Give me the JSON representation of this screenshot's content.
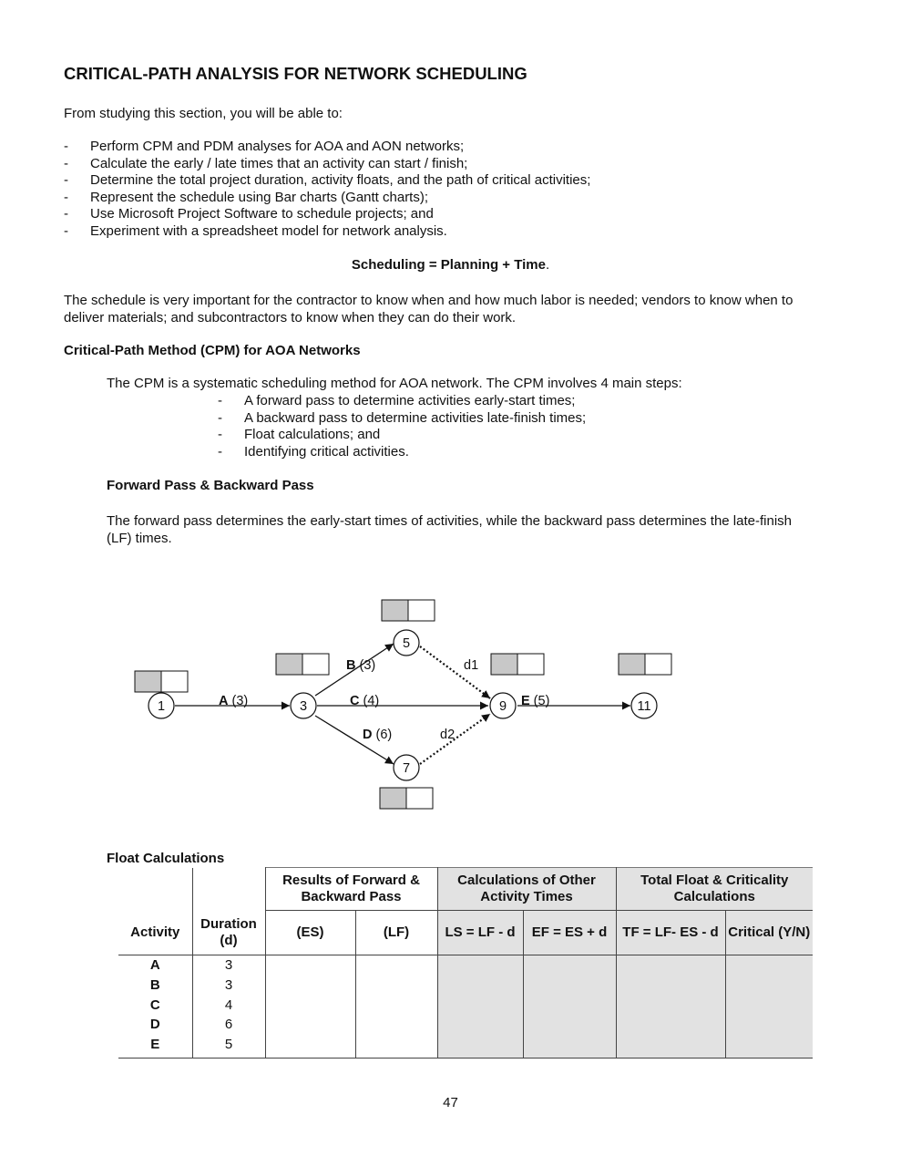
{
  "title": "CRITICAL-PATH ANALYSIS FOR NETWORK SCHEDULING",
  "intro": "From studying this section, you will be able to:",
  "objectives": [
    "Perform CPM and PDM analyses for AOA and AON networks;",
    "Calculate the early / late times that an activity can start / finish;",
    "Determine the total project duration, activity floats, and the path of critical activities;",
    "Represent the schedule using Bar charts (Gantt charts);",
    "Use Microsoft Project Software to schedule projects; and",
    "Experiment with a spreadsheet model for network analysis."
  ],
  "bullet_dash": "-",
  "formula": {
    "bold": "Scheduling = Planning + Time",
    "tail": "."
  },
  "schedule_paragraph": "The schedule is very important for the contractor to know when and how much labor is needed; vendors to know when to deliver materials; and subcontractors to know when they can do their work.",
  "cpm_heading": "Critical-Path Method (CPM) for AOA Networks",
  "cpm_intro": "The CPM is a systematic scheduling method for AOA network. The CPM involves 4 main steps:",
  "cpm_steps": [
    "A forward pass to determine activities early-start times;",
    "A backward pass to determine activities late-finish times;",
    "Float calculations; and",
    "Identifying critical activities."
  ],
  "pass_heading": "Forward Pass & Backward Pass",
  "pass_paragraph": "The forward pass determines the early-start times of activities, while the backward pass determines the late-finish (LF) times.",
  "network": {
    "nodes": [
      "1",
      "3",
      "5",
      "7",
      "9",
      "11"
    ],
    "activities": [
      {
        "name": "A",
        "duration": "(3)",
        "from": "1",
        "to": "3"
      },
      {
        "name": "B",
        "duration": "(3)",
        "from": "3",
        "to": "5"
      },
      {
        "name": "C",
        "duration": "(4)",
        "from": "3",
        "to": "9"
      },
      {
        "name": "D",
        "duration": "(6)",
        "from": "3",
        "to": "7"
      },
      {
        "name": "E",
        "duration": "(5)",
        "from": "9",
        "to": "11"
      }
    ],
    "dummies": [
      {
        "name": "d1",
        "from": "5",
        "to": "9"
      },
      {
        "name": "d2",
        "from": "7",
        "to": "9"
      }
    ],
    "box_fill_color": "#c8c8c8"
  },
  "float_table": {
    "title": "Float Calculations",
    "group_headers": [
      "Results of Forward & Backward Pass",
      "Calculations of Other Activity Times",
      "Total Float & Criticality Calculations"
    ],
    "columns": [
      "Activity",
      "Duration (d)",
      "(ES)",
      "(LF)",
      "LS = LF - d",
      "EF = ES + d",
      "TF = LF- ES - d",
      "Critical (Y/N)"
    ],
    "rows": [
      {
        "activity": "A",
        "duration": "3"
      },
      {
        "activity": "B",
        "duration": "3"
      },
      {
        "activity": "C",
        "duration": "4"
      },
      {
        "activity": "D",
        "duration": "6"
      },
      {
        "activity": "E",
        "duration": "5"
      }
    ],
    "shade_color": "#e2e2e2"
  },
  "page_number": "47"
}
